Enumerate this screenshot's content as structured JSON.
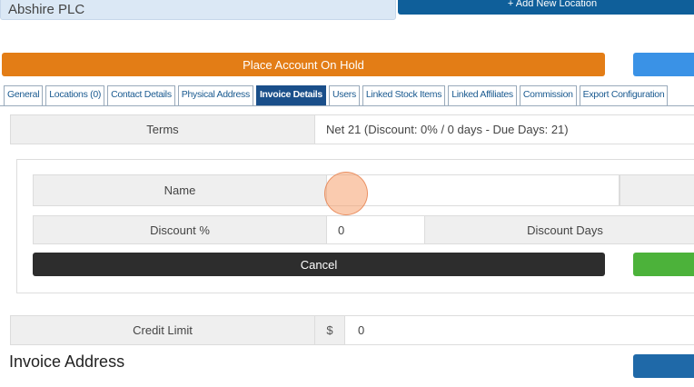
{
  "header": {
    "company_name": "Abshire PLC",
    "add_location_label": "+ Add New Location"
  },
  "actions": {
    "hold_label": "Place Account On Hold"
  },
  "tabs": [
    {
      "label": "General"
    },
    {
      "label": "Locations (0)"
    },
    {
      "label": "Contact Details"
    },
    {
      "label": "Physical Address"
    },
    {
      "label": "Invoice Details",
      "active": true
    },
    {
      "label": "Users"
    },
    {
      "label": "Linked Stock Items"
    },
    {
      "label": "Linked Affiliates"
    },
    {
      "label": "Commission"
    },
    {
      "label": "Export Configuration"
    }
  ],
  "terms": {
    "label": "Terms",
    "value": "Net 21 (Discount: 0% / 0 days - Due Days: 21)"
  },
  "edit_form": {
    "name_label": "Name",
    "name_value": "",
    "discount_label": "Discount %",
    "discount_value": "0",
    "discount_days_label": "Discount Days",
    "cancel_label": "Cancel"
  },
  "credit": {
    "label": "Credit Limit",
    "currency": "$",
    "value": "0"
  },
  "invoice_address": {
    "heading": "Invoice Address"
  },
  "colors": {
    "hold": "#e37d16",
    "primary": "#0f5f9a",
    "active_tab": "#1a4f8a",
    "success": "#4cb23a",
    "dark": "#2d2d2d"
  }
}
